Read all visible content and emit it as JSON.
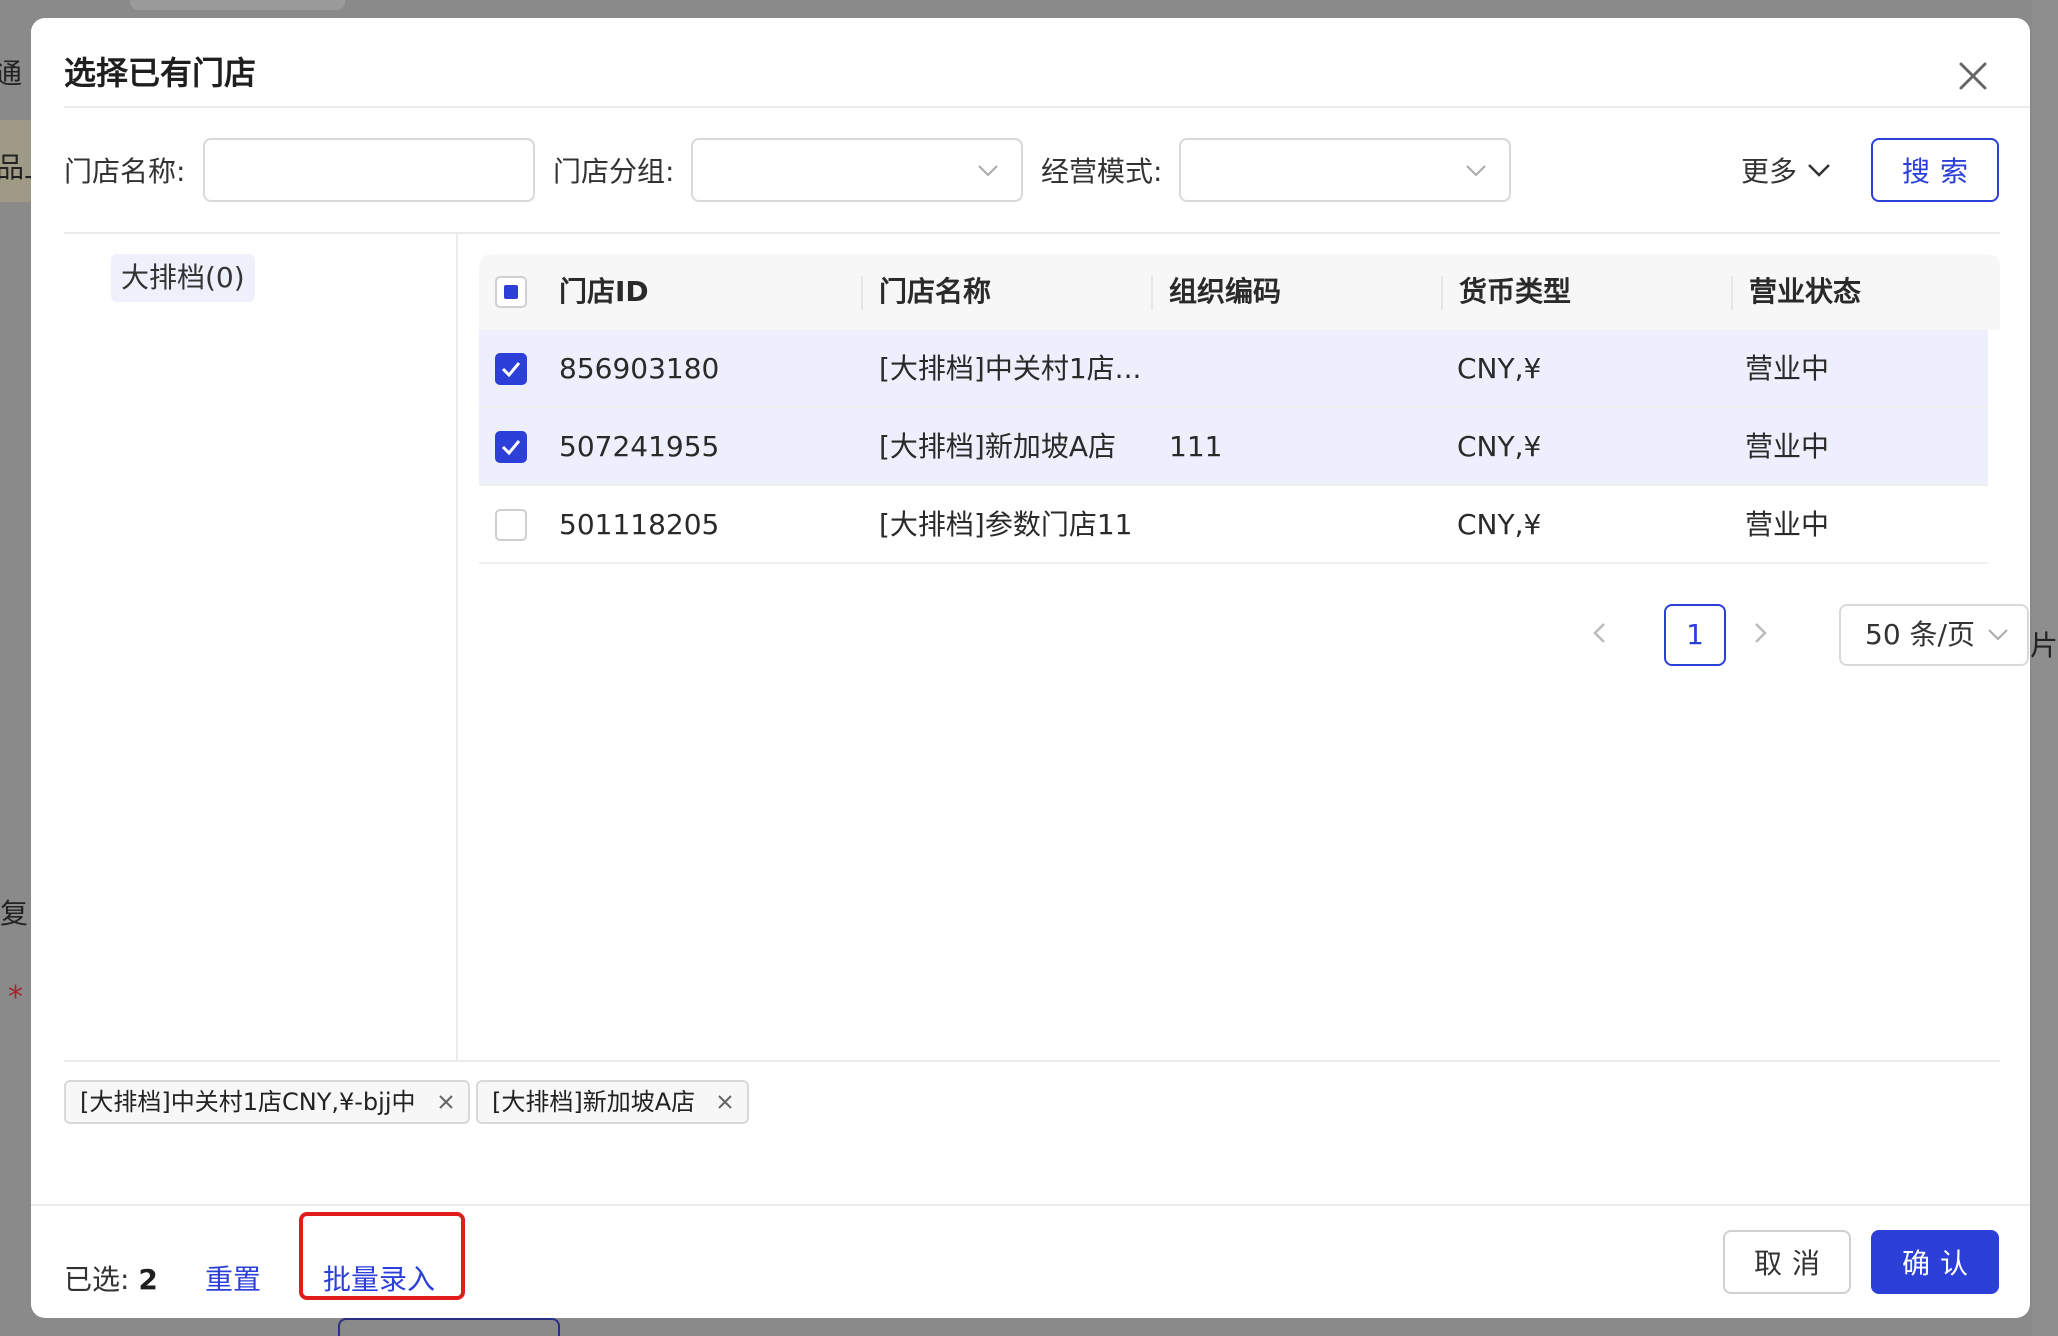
{
  "background": {
    "fragments": [
      "通",
      "品上",
      "复",
      "片"
    ]
  },
  "dialog": {
    "title": "选择已有门店",
    "close_icon": "close-icon"
  },
  "filters": {
    "store_name_label": "门店名称:",
    "store_name_value": "",
    "store_group_label": "门店分组:",
    "store_group_value": "",
    "business_mode_label": "经营模式:",
    "business_mode_value": "",
    "more_label": "更多",
    "search_label": "搜索"
  },
  "tree": {
    "items": [
      {
        "label": "大排档(0)"
      }
    ]
  },
  "table": {
    "columns": [
      "门店ID",
      "门店名称",
      "组织编码",
      "货币类型",
      "营业状态"
    ],
    "rows": [
      {
        "checked": true,
        "id": "856903180",
        "name": "[大排档]中关村1店...",
        "org_code": "",
        "currency": "CNY,¥",
        "status": "营业中"
      },
      {
        "checked": true,
        "id": "507241955",
        "name": "[大排档]新加坡A店",
        "org_code": "111",
        "currency": "CNY,¥",
        "status": "营业中"
      },
      {
        "checked": false,
        "id": "501118205",
        "name": "[大排档]参数门店11",
        "org_code": "",
        "currency": "CNY,¥",
        "status": "营业中"
      }
    ]
  },
  "pagination": {
    "current_page": "1",
    "page_size": "50 条/页"
  },
  "selected_chips": [
    {
      "label": "[大排档]中关村1店CNY,¥-bjj中"
    },
    {
      "label": "[大排档]新加坡A店"
    }
  ],
  "footer": {
    "selected_label": "已选:",
    "selected_count": "2",
    "reset_label": "重置",
    "batch_label": "批量录入",
    "cancel_label": "取消",
    "confirm_label": "确认"
  },
  "colors": {
    "primary": "#2c3fd8",
    "highlight": "#e21b1b",
    "selected_row": "#eeeffc"
  }
}
